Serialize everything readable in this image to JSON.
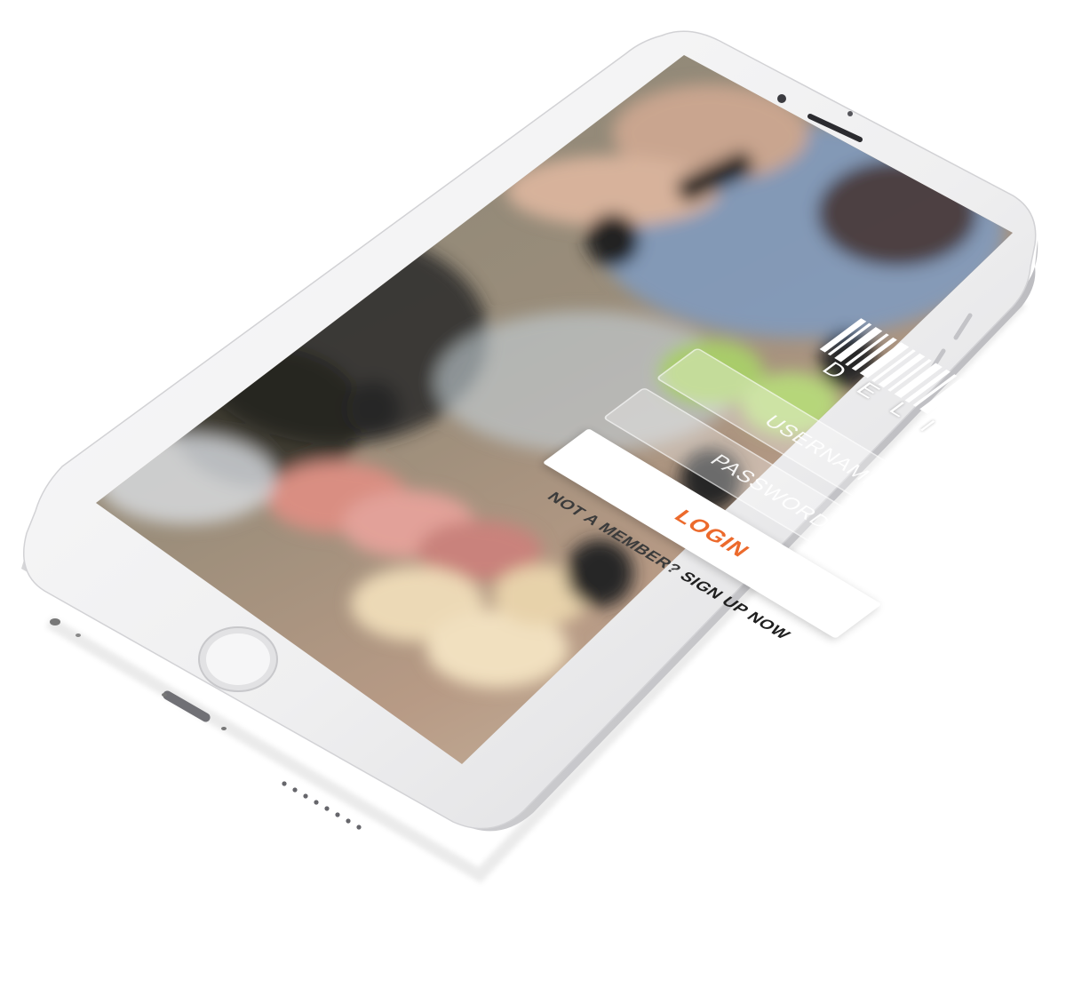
{
  "app": {
    "logo_text": "DELI",
    "username_placeholder": "USERNAME",
    "password_placeholder": "PASSWORD",
    "login_label": "LOGIN",
    "signup_prompt": "NOT A MEMBER?",
    "signup_link": "SIGN UP NOW"
  },
  "colors": {
    "accent": "#ec6a2c",
    "phone_body": "#f4f4f5",
    "screen_bezel": "#ffffff"
  },
  "icons": {
    "home_button": "home-button",
    "camera": "front-camera-icon",
    "speaker": "earpiece-speaker-icon"
  }
}
